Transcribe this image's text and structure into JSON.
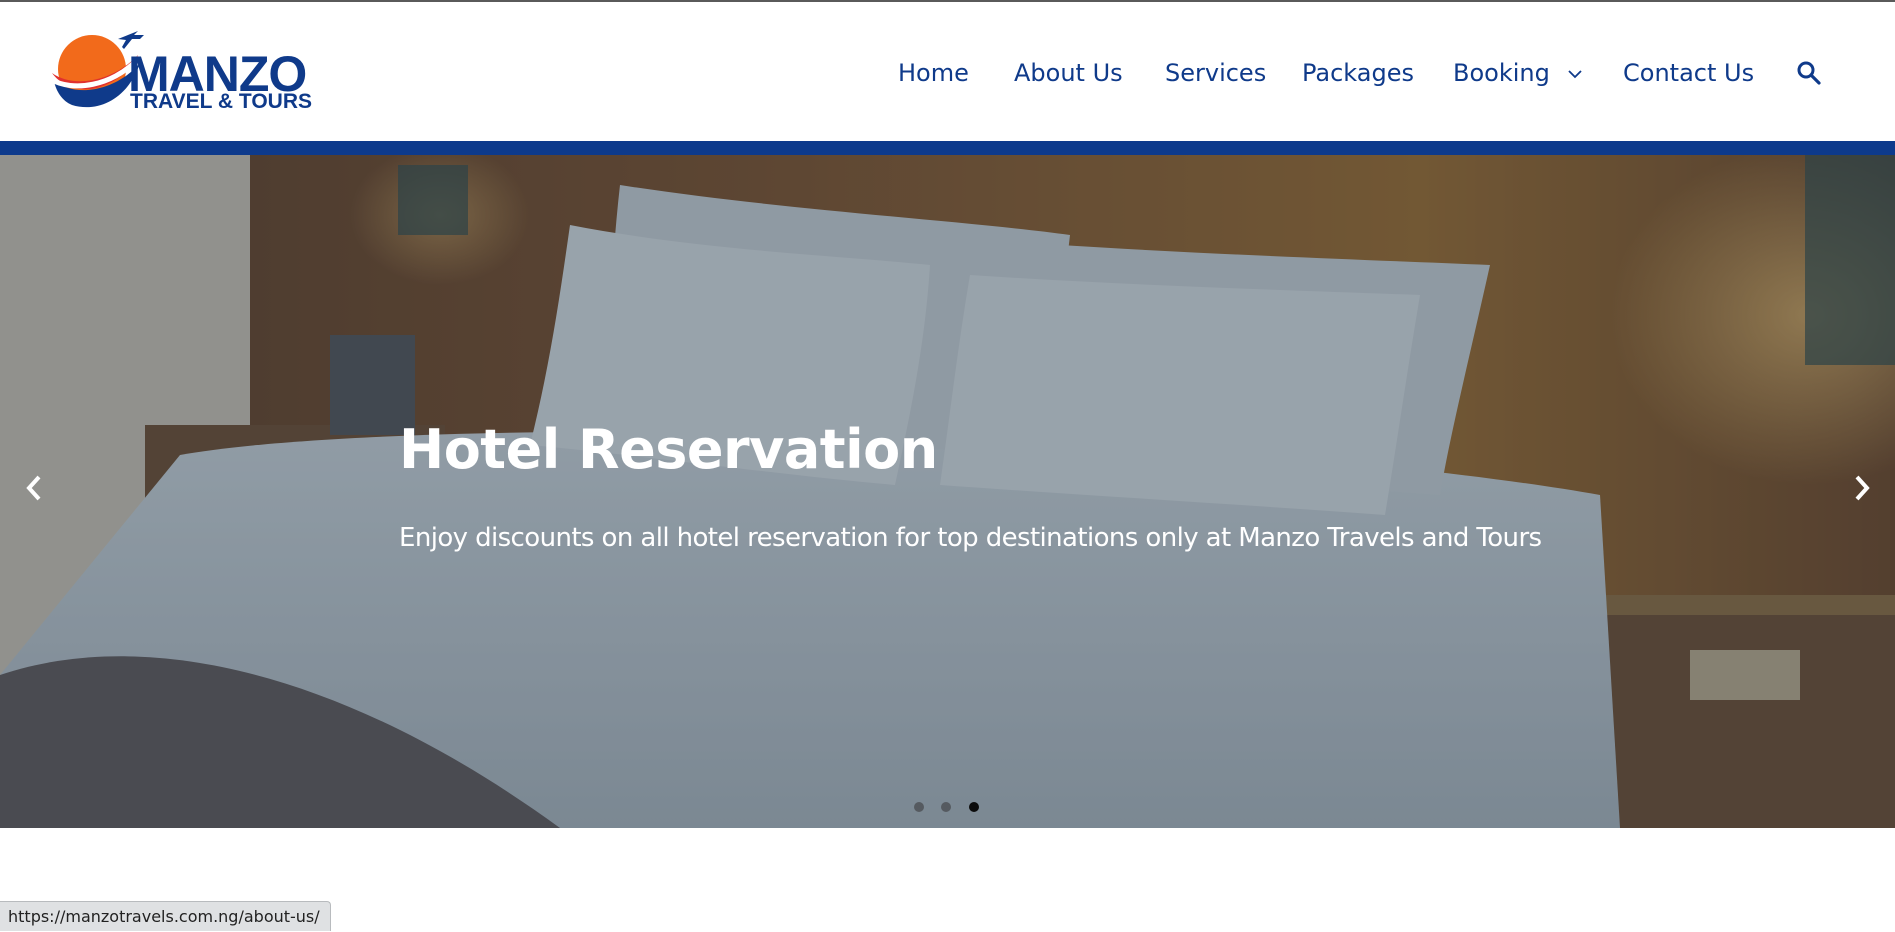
{
  "brand": {
    "name": "MANZO",
    "tagline": "TRAVEL & TOURS",
    "colors": {
      "primary": "#0f3a8a",
      "orange": "#f26a1b",
      "red": "#e0312e"
    }
  },
  "nav": {
    "items": [
      {
        "label": "Home"
      },
      {
        "label": "About Us"
      },
      {
        "label": "Services"
      },
      {
        "label": "Packages"
      },
      {
        "label": "Booking",
        "has_dropdown": true
      },
      {
        "label": "Contact Us"
      }
    ],
    "search_icon": "search-icon"
  },
  "hero": {
    "title": "Hotel Reservation",
    "subtitle": "Enjoy discounts on all hotel reservation for top destinations only at Manzo Travels and Tours",
    "prev_icon": "chevron-left-icon",
    "next_icon": "chevron-right-icon",
    "slides_total": 3,
    "active_slide": 3
  },
  "status_bar": {
    "url": "https://manzotravels.com.ng/about-us/"
  }
}
